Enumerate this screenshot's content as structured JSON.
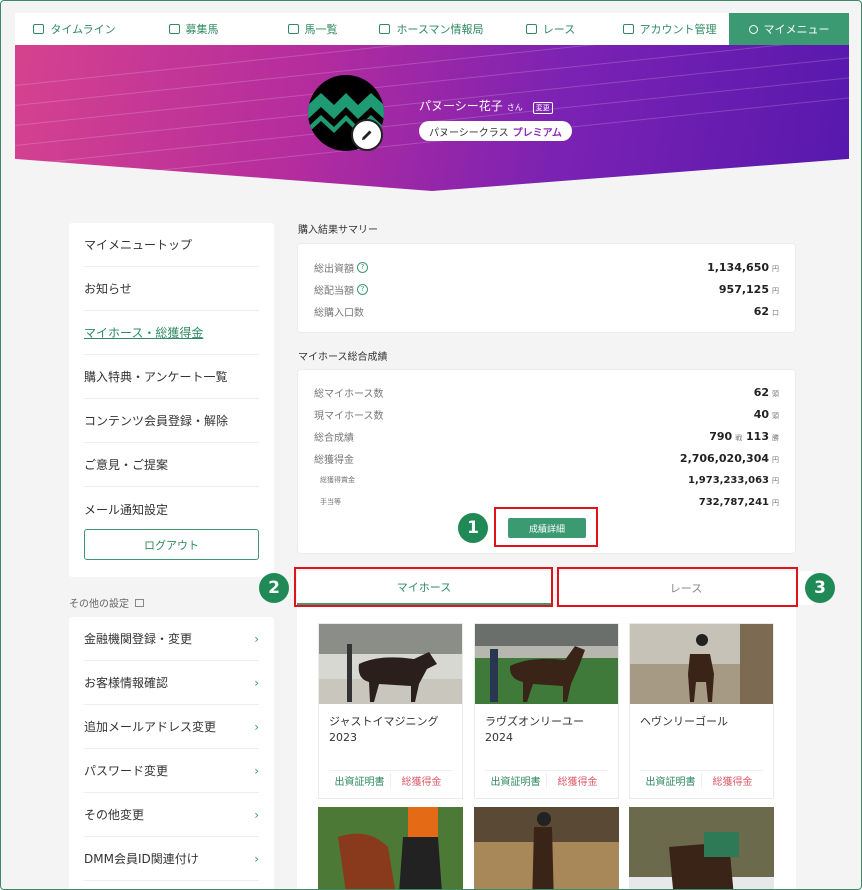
{
  "nav": {
    "items": [
      {
        "label": "タイムライン",
        "icon": "timeline-icon"
      },
      {
        "label": "募集馬",
        "icon": "horse-list-icon"
      },
      {
        "label": "馬一覧",
        "icon": "horse-icon"
      },
      {
        "label": "ホースマン情報局",
        "icon": "info-icon"
      },
      {
        "label": "レース",
        "icon": "race-icon"
      },
      {
        "label": "アカウント管理",
        "icon": "account-icon"
      },
      {
        "label": "マイメニュー",
        "icon": "user-icon"
      }
    ]
  },
  "profile": {
    "name": "パヌーシー花子",
    "honorific": "さん",
    "change_label": "変更",
    "class_prefix": "パヌーシークラス",
    "class_name": "プレミアム"
  },
  "sidebar": {
    "items": [
      {
        "label": "マイメニュートップ"
      },
      {
        "label": "お知らせ"
      },
      {
        "label": "マイホース・総獲得金"
      },
      {
        "label": "購入特典・アンケート一覧"
      },
      {
        "label": "コンテンツ会員登録・解除"
      },
      {
        "label": "ご意見・ご提案"
      },
      {
        "label": "メール通知設定"
      }
    ],
    "logout_label": "ログアウト",
    "other_settings_label": "その他の設定",
    "other_items": [
      {
        "label": "金融機関登録・変更"
      },
      {
        "label": "お客様情報確認"
      },
      {
        "label": "追加メールアドレス変更"
      },
      {
        "label": "パスワード変更"
      },
      {
        "label": "その他変更"
      },
      {
        "label": "DMM会員ID関連付け"
      }
    ]
  },
  "purchase_summary": {
    "title": "購入結果サマリー",
    "rows": [
      {
        "label": "総出資額",
        "value": "1,134,650",
        "unit": "円",
        "help": "?"
      },
      {
        "label": "総配当額",
        "value": "957,125",
        "unit": "円",
        "help": "?"
      },
      {
        "label": "総購入口数",
        "value": "62",
        "unit": "口"
      }
    ]
  },
  "myhorse_summary": {
    "title": "マイホース総合成績",
    "rows": [
      {
        "label": "総マイホース数",
        "value": "62",
        "unit": "頭"
      },
      {
        "label": "現マイホース数",
        "value": "40",
        "unit": "頭"
      },
      {
        "label": "総合成績",
        "value": "790",
        "unit": "戦",
        "value2": "113",
        "unit2": "勝"
      },
      {
        "label": "総獲得金",
        "value": "2,706,020,304",
        "unit": "円"
      },
      {
        "label": "総獲得賞金",
        "value": "1,973,233,063",
        "unit": "円"
      },
      {
        "label": "手当等",
        "value": "732,787,241",
        "unit": "円"
      }
    ],
    "detail_button": "成績詳細"
  },
  "markers": [
    "1",
    "2",
    "3"
  ],
  "tabs": [
    {
      "label": "マイホース"
    },
    {
      "label": "レース"
    }
  ],
  "horses": [
    {
      "name": "ジャストイマジニング2023",
      "cert": "出資証明書",
      "prize": "総獲得金"
    },
    {
      "name": "ラヴズオンリーユー2024",
      "cert": "出資証明書",
      "prize": "総獲得金"
    },
    {
      "name": "ヘヴンリーゴール",
      "cert": "出資証明書",
      "prize": "総獲得金"
    }
  ],
  "colors": {
    "accent": "#3c9a73",
    "highlight_box": "#e0131c",
    "marker": "#1f8a55"
  }
}
